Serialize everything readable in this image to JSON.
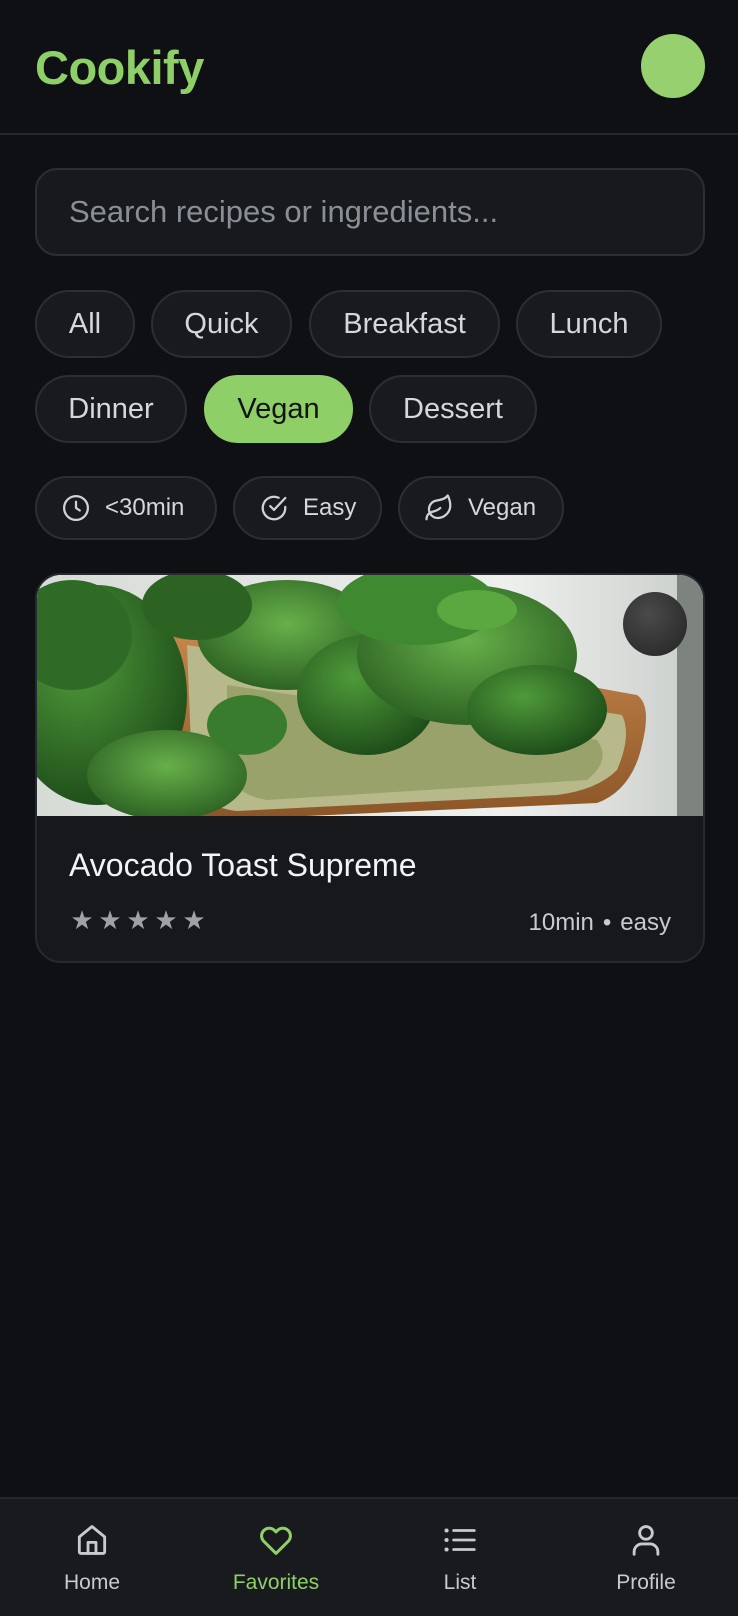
{
  "header": {
    "logo": "Cookify"
  },
  "search": {
    "placeholder": "Search recipes or ingredients..."
  },
  "categories": [
    {
      "label": "All",
      "active": false
    },
    {
      "label": "Quick",
      "active": false
    },
    {
      "label": "Breakfast",
      "active": false
    },
    {
      "label": "Lunch",
      "active": false
    },
    {
      "label": "Dinner",
      "active": false
    },
    {
      "label": "Vegan",
      "active": true
    },
    {
      "label": "Dessert",
      "active": false
    }
  ],
  "filters": [
    {
      "icon": "clock-icon",
      "label": "<30min"
    },
    {
      "icon": "check-circle-icon",
      "label": "Easy"
    },
    {
      "icon": "leaf-icon",
      "label": "Vegan"
    }
  ],
  "recipe": {
    "title": "Avocado Toast Supreme",
    "rating": 5,
    "time": "10min",
    "separator": "•",
    "difficulty": "easy"
  },
  "bottom_nav": [
    {
      "icon": "home-icon",
      "label": "Home",
      "active": false
    },
    {
      "icon": "heart-icon",
      "label": "Favorites",
      "active": true
    },
    {
      "icon": "list-icon",
      "label": "List",
      "active": false
    },
    {
      "icon": "user-icon",
      "label": "Profile",
      "active": false
    }
  ],
  "colors": {
    "accent": "#8fcf68",
    "background": "#0f1013",
    "surface": "#181a1e"
  }
}
